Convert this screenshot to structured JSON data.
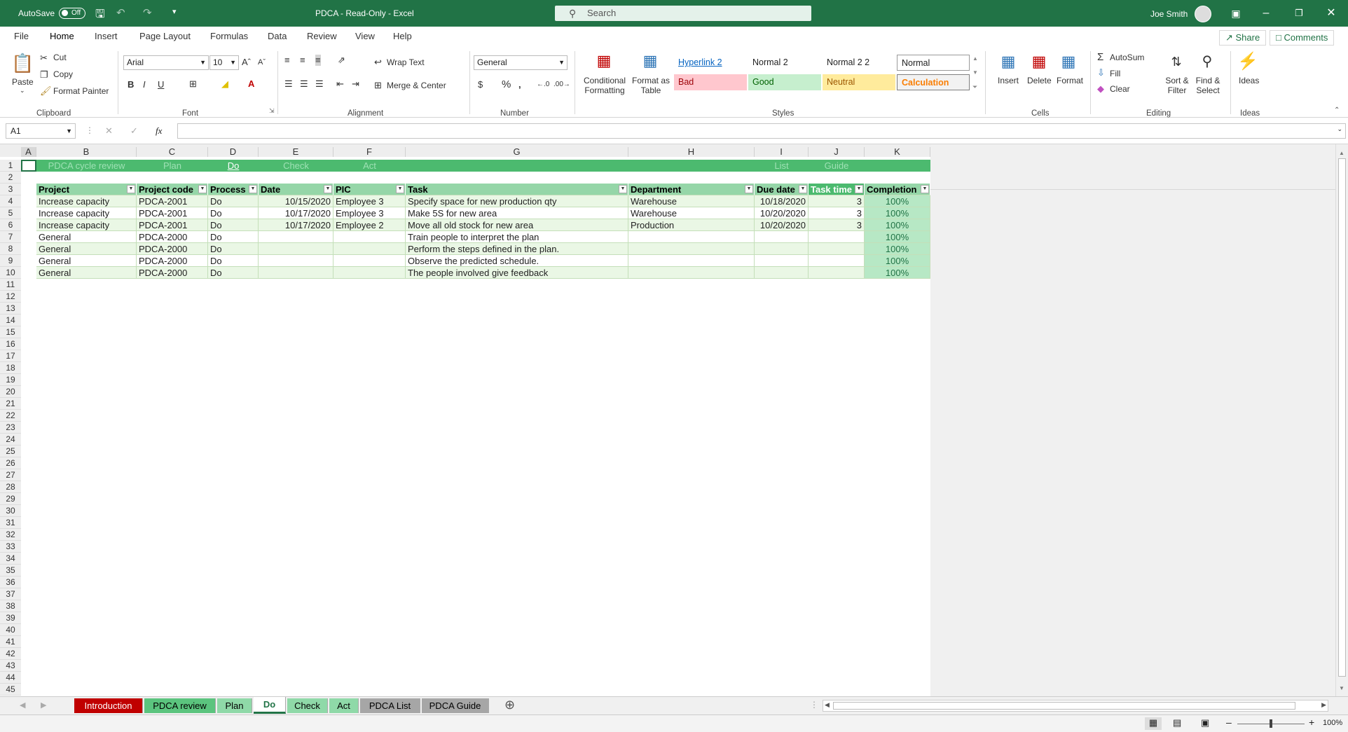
{
  "titlebar": {
    "autosave_label": "AutoSave",
    "toggle_state": "Off",
    "title": "PDCA  -  Read-Only  -  Excel",
    "search_placeholder": "Search",
    "user": "Joe Smith"
  },
  "menu": {
    "tabs": [
      "File",
      "Home",
      "Insert",
      "Page Layout",
      "Formulas",
      "Data",
      "Review",
      "View",
      "Help"
    ],
    "active": "Home",
    "share": "Share",
    "comments": "Comments"
  },
  "ribbon": {
    "clipboard": {
      "paste": "Paste",
      "cut": "Cut",
      "copy": "Copy",
      "format_painter": "Format Painter",
      "label": "Clipboard"
    },
    "font": {
      "name": "Arial",
      "size": "10",
      "label": "Font"
    },
    "alignment": {
      "wrap_text": "Wrap Text",
      "merge_center": "Merge & Center",
      "label": "Alignment"
    },
    "number": {
      "format": "General",
      "label": "Number"
    },
    "styles": {
      "conditional_formatting": [
        "Conditional",
        "Formatting"
      ],
      "format_as_table": [
        "Format as",
        "Table"
      ],
      "cells": [
        "Hyperlink 2",
        "Normal 2",
        "Normal 2 2",
        "Normal",
        "Bad",
        "Good",
        "Neutral",
        "Calculation"
      ],
      "label": "Styles"
    },
    "cells": {
      "insert": "Insert",
      "delete": "Delete",
      "format": "Format",
      "label": "Cells"
    },
    "editing": {
      "autosum": "AutoSum",
      "fill": "Fill",
      "clear": "Clear",
      "sort_filter": [
        "Sort &",
        "Filter"
      ],
      "find_select": [
        "Find &",
        "Select"
      ],
      "label": "Editing"
    },
    "ideas": {
      "ideas": "Ideas",
      "label": "Ideas"
    }
  },
  "formula_bar": {
    "name_box": "A1",
    "fx": "fx",
    "value": ""
  },
  "columns": [
    "A",
    "B",
    "C",
    "D",
    "E",
    "F",
    "G",
    "H",
    "I",
    "J",
    "K"
  ],
  "row1": [
    "PDCA cycle review",
    "Plan",
    "Do",
    "Check",
    "Act",
    "List",
    "Guide"
  ],
  "table": {
    "headers": [
      "Project",
      "Project code",
      "Process",
      "Date",
      "PIC",
      "Task",
      "Department",
      "Due date",
      "Task time",
      "Completion"
    ],
    "rows": [
      [
        "Increase capacity",
        "PDCA-2001",
        "Do",
        "10/15/2020",
        "Employee 3",
        "Specify space for new production qty",
        "Warehouse",
        "10/18/2020",
        "3",
        "100%"
      ],
      [
        "Increase capacity",
        "PDCA-2001",
        "Do",
        "10/17/2020",
        "Employee 3",
        "Make 5S for new area",
        "Warehouse",
        "10/20/2020",
        "3",
        "100%"
      ],
      [
        "Increase capacity",
        "PDCA-2001",
        "Do",
        "10/17/2020",
        "Employee 2",
        "Move all old stock for new area",
        "Production",
        "10/20/2020",
        "3",
        "100%"
      ],
      [
        "General",
        "PDCA-2000",
        "Do",
        "",
        "",
        "Train people to interpret the plan",
        "",
        "",
        "",
        "100%"
      ],
      [
        "General",
        "PDCA-2000",
        "Do",
        "",
        "",
        "Perform the steps defined in the plan.",
        "",
        "",
        "",
        "100%"
      ],
      [
        "General",
        "PDCA-2000",
        "Do",
        "",
        "",
        "Observe the predicted schedule.",
        "",
        "",
        "",
        "100%"
      ],
      [
        "General",
        "PDCA-2000",
        "Do",
        "",
        "",
        "The people involved give feedback",
        "",
        "",
        "",
        "100%"
      ]
    ]
  },
  "sheet_tabs": [
    {
      "label": "Introduction",
      "color": "#c00000",
      "text": "#ffffff"
    },
    {
      "label": "PDCA review",
      "color": "#5bc47e",
      "text": "#000000"
    },
    {
      "label": "Plan",
      "color": "#8fd9a8",
      "text": "#000000"
    },
    {
      "label": "Do",
      "color": "#ffffff",
      "text": "#217346"
    },
    {
      "label": "Check",
      "color": "#8fd9a8",
      "text": "#000000"
    },
    {
      "label": "Act",
      "color": "#8fd9a8",
      "text": "#000000"
    },
    {
      "label": "PDCA List",
      "color": "#a6a6a6",
      "text": "#000000"
    },
    {
      "label": "PDCA Guide",
      "color": "#a6a6a6",
      "text": "#000000"
    }
  ],
  "status": {
    "zoom": "100%"
  }
}
